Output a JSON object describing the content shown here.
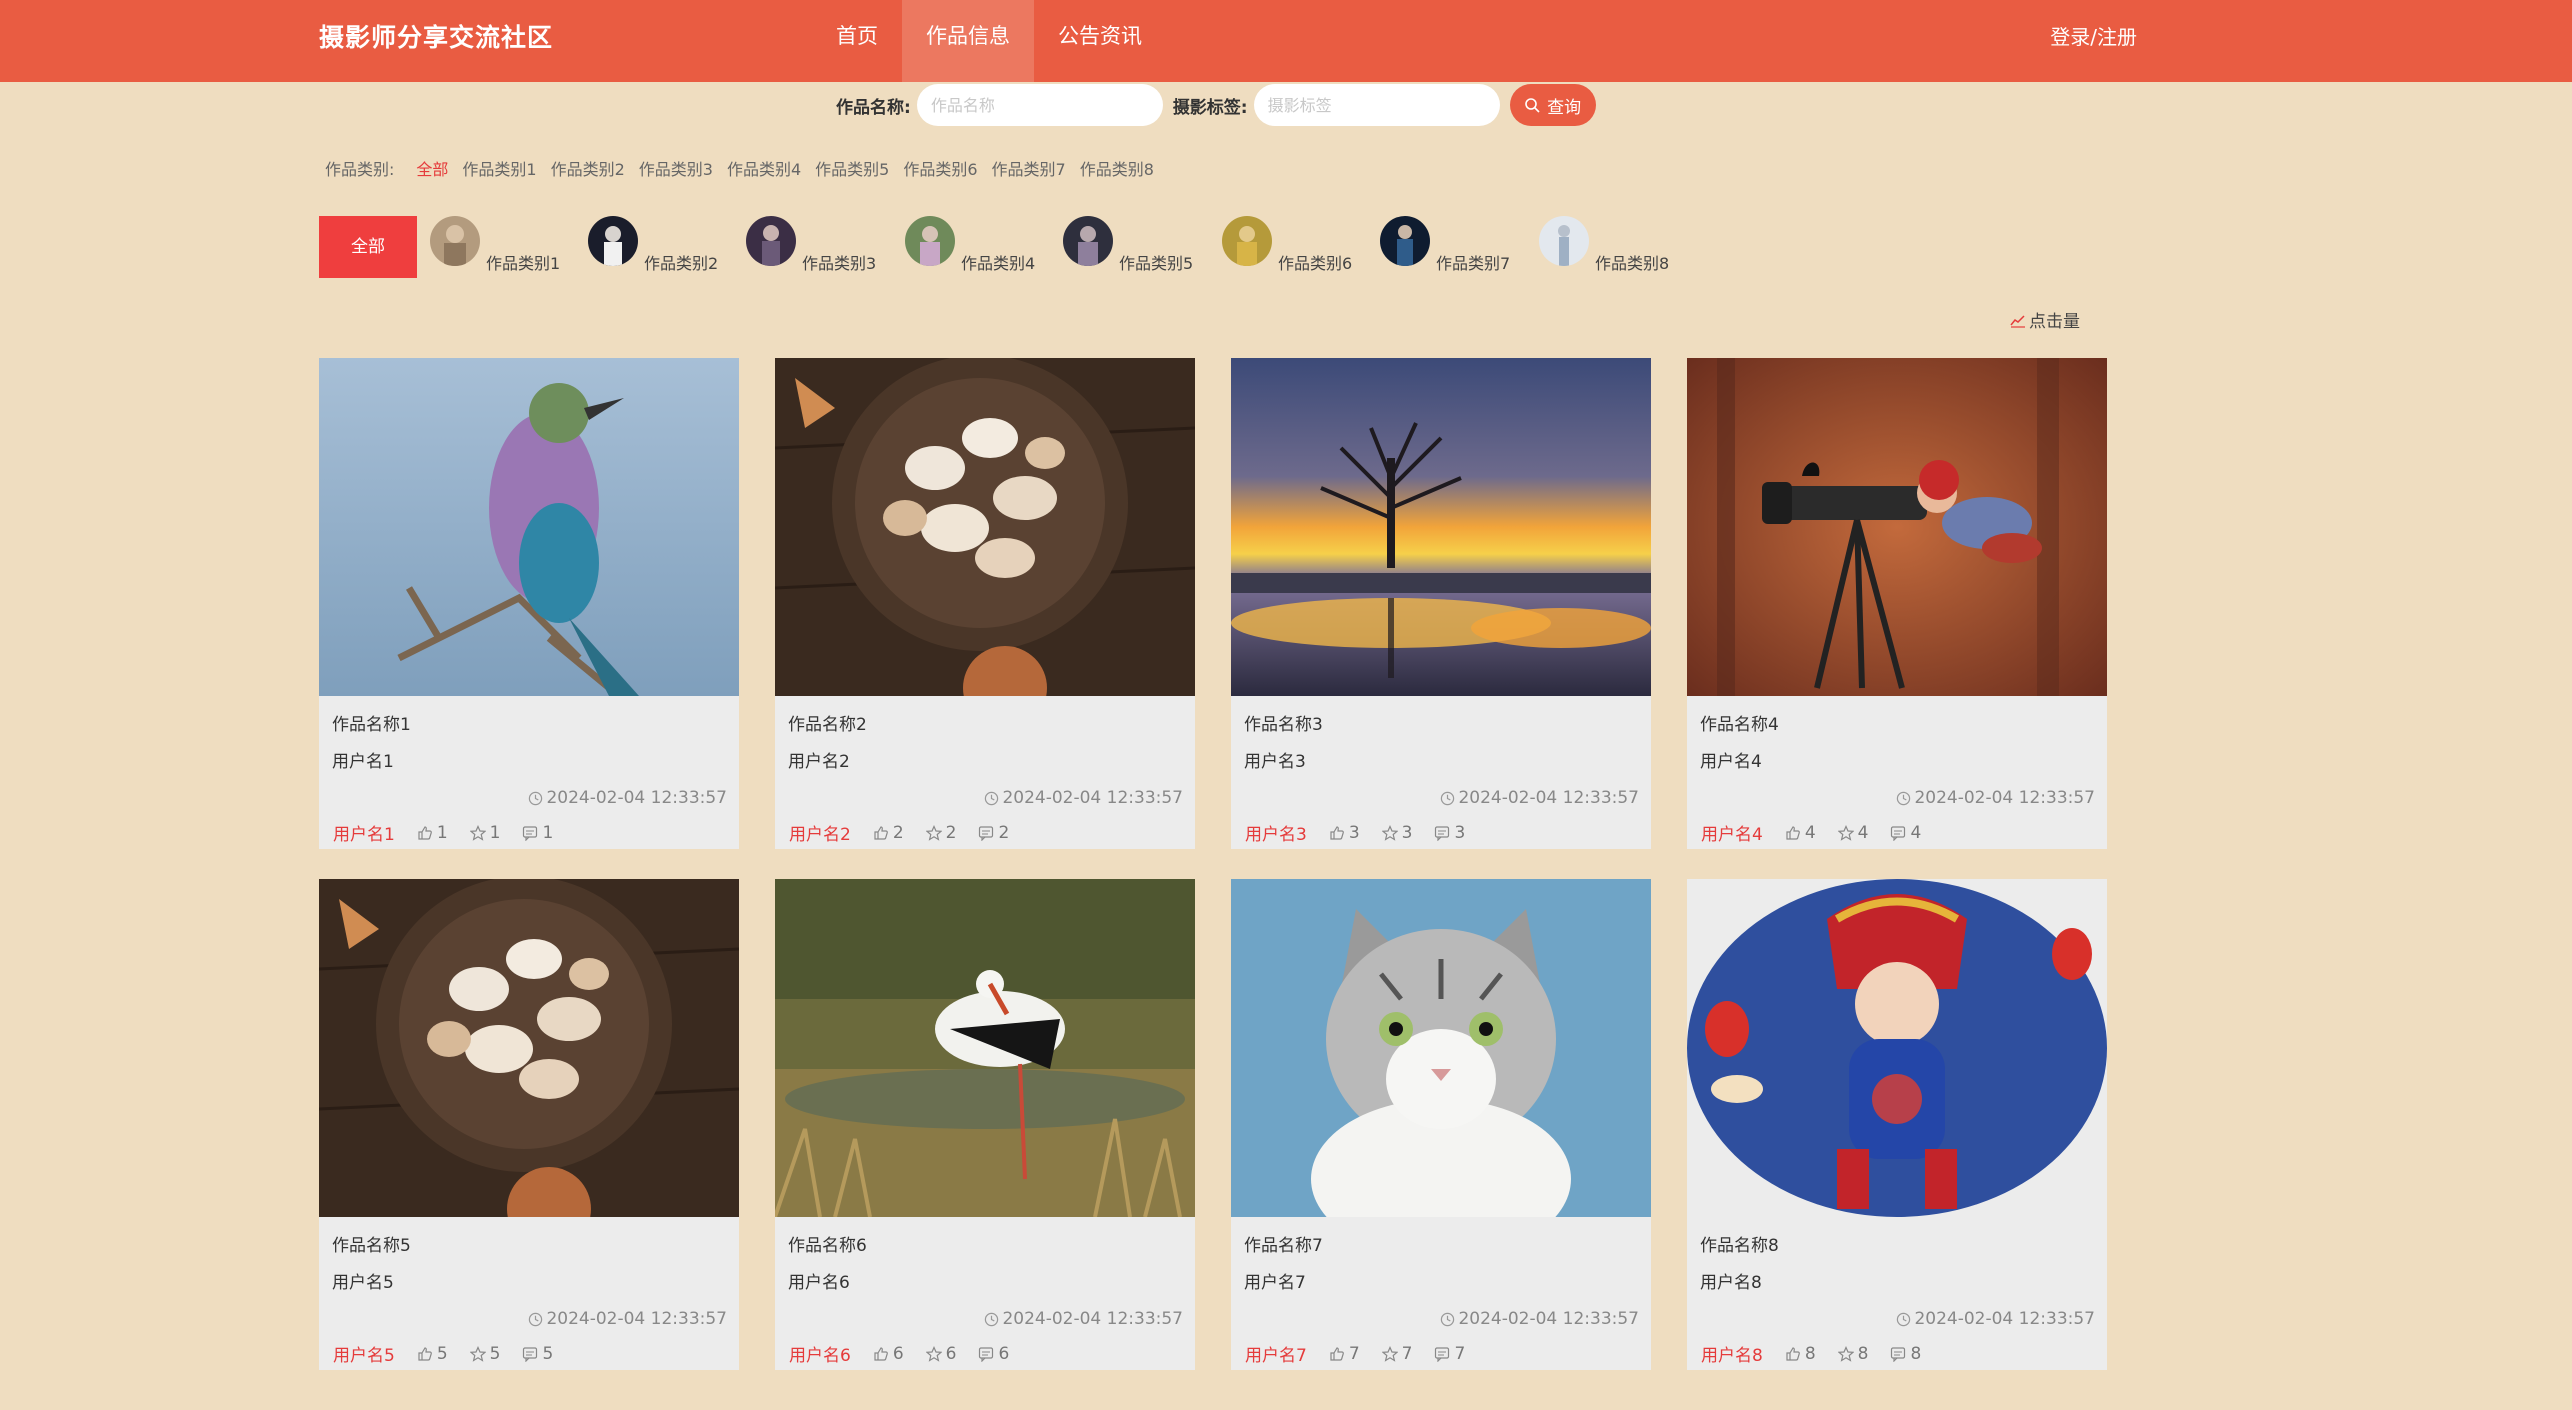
{
  "header": {
    "brand": "摄影师分享交流社区",
    "nav": [
      "首页",
      "作品信息",
      "公告资讯"
    ],
    "active_nav": "作品信息",
    "login": "登录/注册",
    "color": "#e95c42"
  },
  "search": {
    "name_label": "作品名称:",
    "name_placeholder": "作品名称",
    "tag_label": "摄影标签:",
    "tag_placeholder": "摄影标签",
    "button": "查询"
  },
  "category_filter": {
    "label": "作品类别:",
    "items": [
      "全部",
      "作品类别1",
      "作品类别2",
      "作品类别3",
      "作品类别4",
      "作品类别5",
      "作品类别6",
      "作品类别7",
      "作品类别8"
    ],
    "active": "全部"
  },
  "category_avatars": {
    "all_label": "全部",
    "items": [
      "作品类别1",
      "作品类别2",
      "作品类别3",
      "作品类别4",
      "作品类别5",
      "作品类别6",
      "作品类别7",
      "作品类别8"
    ]
  },
  "sort": {
    "label": "点击量"
  },
  "works": [
    {
      "title": "作品名称1",
      "user": "用户名1",
      "time": "2024-02-04 12:33:57",
      "likes": "1",
      "favorites": "1",
      "comments": "1",
      "image": "bird-photo"
    },
    {
      "title": "作品名称2",
      "user": "用户名2",
      "time": "2024-02-04 12:33:57",
      "likes": "2",
      "favorites": "2",
      "comments": "2",
      "image": "garlic-bowl-photo"
    },
    {
      "title": "作品名称3",
      "user": "用户名3",
      "time": "2024-02-04 12:33:57",
      "likes": "3",
      "favorites": "3",
      "comments": "3",
      "image": "sunset-tree-photo"
    },
    {
      "title": "作品名称4",
      "user": "用户名4",
      "time": "2024-02-04 12:33:57",
      "likes": "4",
      "favorites": "4",
      "comments": "4",
      "image": "camera-kid-photo"
    },
    {
      "title": "作品名称5",
      "user": "用户名5",
      "time": "2024-02-04 12:33:57",
      "likes": "5",
      "favorites": "5",
      "comments": "5",
      "image": "garlic-bowl-photo"
    },
    {
      "title": "作品名称6",
      "user": "用户名6",
      "time": "2024-02-04 12:33:57",
      "likes": "6",
      "favorites": "6",
      "comments": "6",
      "image": "stork-photo"
    },
    {
      "title": "作品名称7",
      "user": "用户名7",
      "time": "2024-02-04 12:33:57",
      "likes": "7",
      "favorites": "7",
      "comments": "7",
      "image": "cat-photo"
    },
    {
      "title": "作品名称8",
      "user": "用户名8",
      "time": "2024-02-04 12:33:57",
      "likes": "8",
      "favorites": "8",
      "comments": "8",
      "image": "baby-photo"
    }
  ]
}
